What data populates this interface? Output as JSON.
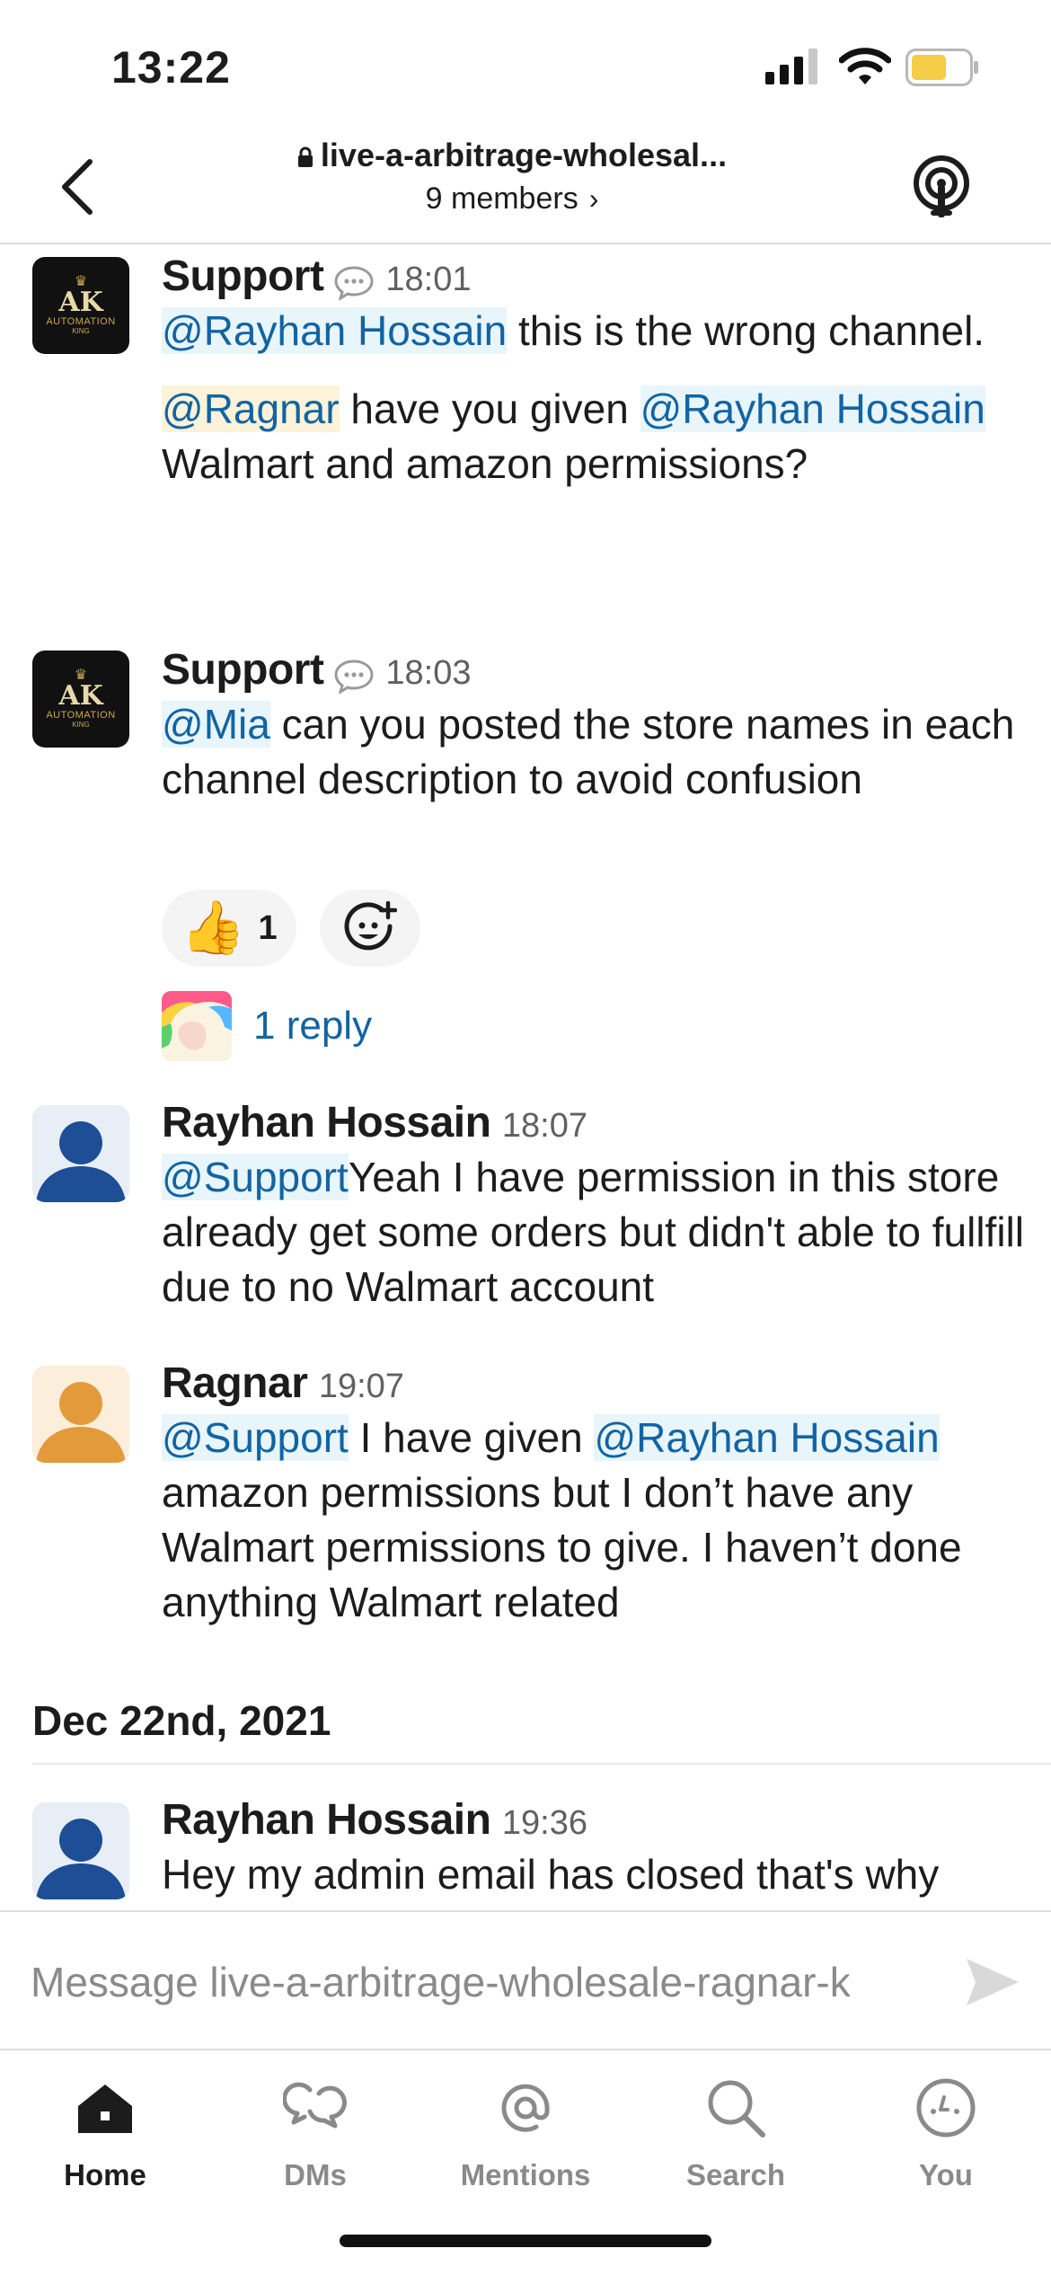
{
  "status_bar": {
    "time": "13:22",
    "battery_color": "#f4cc45"
  },
  "header": {
    "channel_name": "live-a-arbitrage-wholesal...",
    "members": "9 members",
    "icons": {
      "back": "chevron-left-icon",
      "lock": "lock-icon",
      "huddle": "headphones-huddle-icon"
    }
  },
  "messages": [
    {
      "author": "Support",
      "time": "18:01",
      "paragraphs": [
        [
          {
            "mention": "@Rayhan Hossain"
          },
          {
            "text": " this is the wrong channel."
          }
        ],
        [
          {
            "mention_me": "@Ragnar"
          },
          {
            "text": " have you given "
          },
          {
            "mention": "@Rayhan Hossain"
          },
          {
            "text": " Walmart and amazon permissions?"
          }
        ]
      ]
    },
    {
      "author": "Support",
      "time": "18:03",
      "paragraphs": [
        [
          {
            "mention": "@Mia"
          },
          {
            "text": " can you posted the store names in each channel description to avoid confusion"
          }
        ]
      ],
      "reactions": [
        {
          "emoji": "👍",
          "count": "1"
        }
      ],
      "replies": "1 reply"
    },
    {
      "author": "Rayhan Hossain",
      "time": "18:07",
      "paragraphs": [
        [
          {
            "mention": "@Support"
          },
          {
            "text": "Yeah I have permission in this store already get some orders but didn't able to fullfill due to no Walmart account"
          }
        ]
      ]
    },
    {
      "author": "Ragnar",
      "time": "19:07",
      "paragraphs": [
        [
          {
            "mention": "@Support"
          },
          {
            "text": " I have given "
          },
          {
            "mention": "@Rayhan Hossain"
          },
          {
            "text": " amazon permissions but I don’t have any Walmart permissions to give. I haven’t done anything Walmart related"
          }
        ]
      ]
    },
    {
      "author": "Rayhan Hossain",
      "time": "19:36",
      "paragraphs": [
        [
          {
            "text": "Hey my admin email has closed that's why"
          }
        ]
      ]
    }
  ],
  "date_divider": "Dec 22nd, 2021",
  "bot_avatar": {
    "monogram": "AK",
    "line1": "AUTOMATION",
    "line2": "KING"
  },
  "composer": {
    "placeholder": "Message live-a-arbitrage-wholesale-ragnar-k"
  },
  "tabs": [
    {
      "label": "Home",
      "icon": "home-icon",
      "active": true
    },
    {
      "label": "DMs",
      "icon": "dms-icon",
      "active": false
    },
    {
      "label": "Mentions",
      "icon": "mentions-icon",
      "active": false
    },
    {
      "label": "Search",
      "icon": "search-icon",
      "active": false
    },
    {
      "label": "You",
      "icon": "you-icon",
      "active": false
    }
  ],
  "colors": {
    "link": "#1264a3",
    "mention_bg": "#e8f5fa",
    "mention_me_bg": "#fdf3d8",
    "text": "#1d1c1d",
    "muted": "#616061"
  }
}
